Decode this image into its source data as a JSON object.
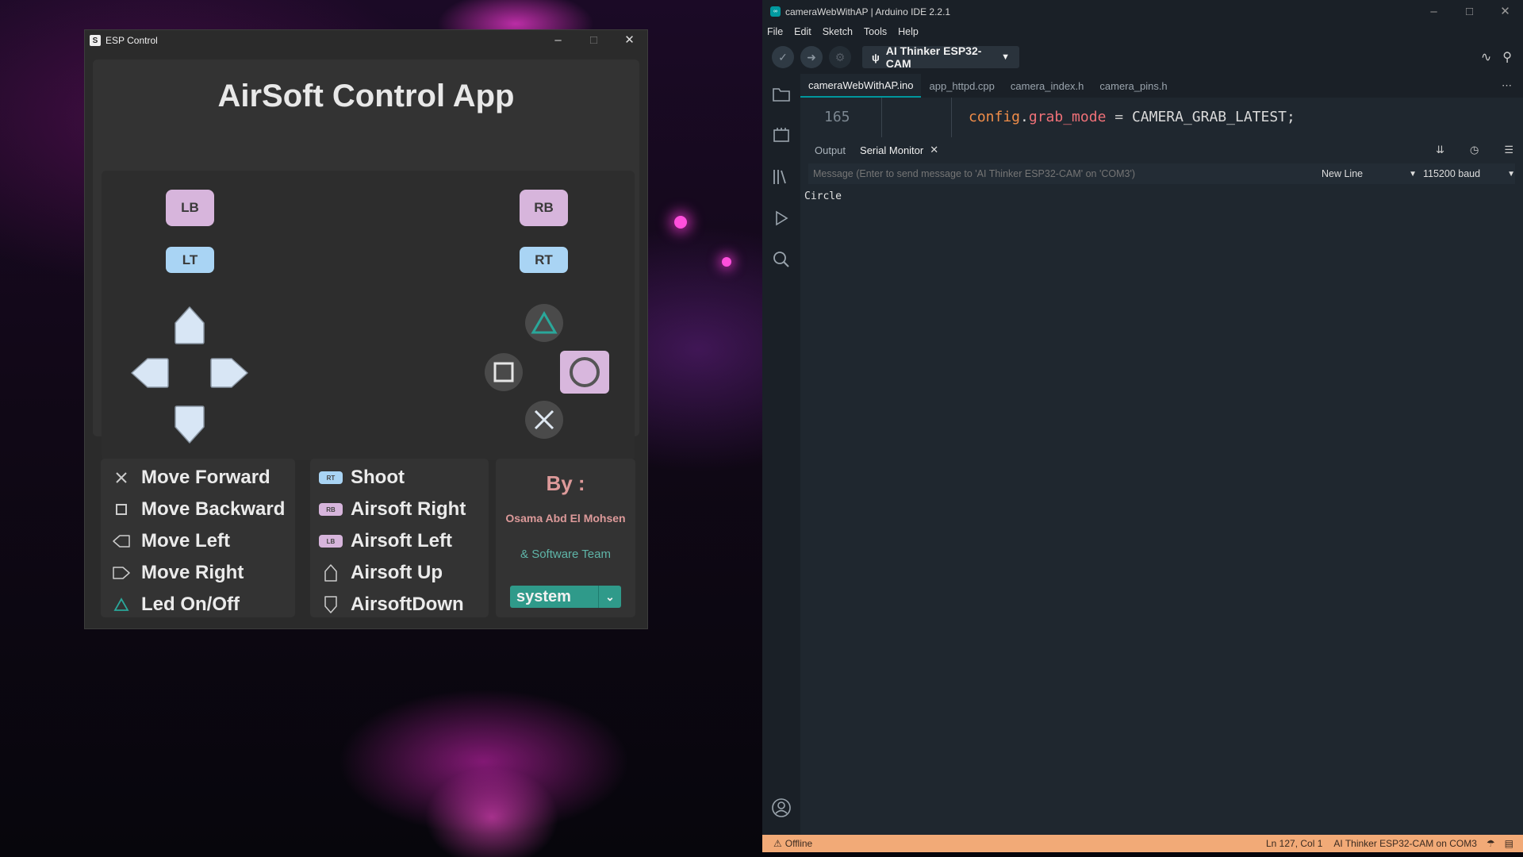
{
  "esp": {
    "window_title": "ESP Control",
    "app_title": "AirSoft Control App",
    "controller": {
      "lb": "LB",
      "rb": "RB",
      "lt": "LT",
      "rt": "RT"
    },
    "legend_left": [
      {
        "icon": "cross-icon",
        "label": "Move Forward"
      },
      {
        "icon": "square-icon",
        "label": "Move Backward"
      },
      {
        "icon": "dpad-left-icon",
        "label": "Move  Left"
      },
      {
        "icon": "dpad-right-icon",
        "label": "Move  Right"
      },
      {
        "icon": "triangle-icon",
        "label": "Led On/Off"
      }
    ],
    "legend_mid": [
      {
        "icon": "rt-tag",
        "tag": "RT",
        "label": "Shoot"
      },
      {
        "icon": "rb-tag",
        "tag": "RB",
        "label": "Airsoft Right"
      },
      {
        "icon": "lb-tag",
        "tag": "LB",
        "label": "Airsoft Left"
      },
      {
        "icon": "dpad-up-icon",
        "label": "Airsoft Up"
      },
      {
        "icon": "dpad-down-icon",
        "label": "AirsoftDown"
      }
    ],
    "credits": {
      "by": "By :",
      "author": "Osama Abd El Mohsen",
      "team": "& Software Team",
      "theme_value": "system"
    },
    "colors": {
      "bumper": "#d7b5dc",
      "trigger": "#a9d4f4",
      "teal": "#2f9a8a",
      "accent_text": "#dd9a9a"
    }
  },
  "ide": {
    "window_title": "cameraWebWithAP | Arduino IDE 2.2.1",
    "menu": [
      "File",
      "Edit",
      "Sketch",
      "Tools",
      "Help"
    ],
    "board": "AI Thinker ESP32-CAM",
    "tabs": [
      "cameraWebWithAP.ino",
      "app_httpd.cpp",
      "camera_index.h",
      "camera_pins.h"
    ],
    "editor": {
      "line_number": "165",
      "code_obj": "config",
      "code_dot": ".",
      "code_prop": "grab_mode",
      "code_eq": " = ",
      "code_val": "CAMERA_GRAB_LATEST;"
    },
    "panel_tabs": {
      "output": "Output",
      "serial": "Serial Monitor"
    },
    "message_placeholder": "Message (Enter to send message to 'AI Thinker ESP32-CAM' on 'COM3')",
    "line_ending": "New Line",
    "baud": "115200 baud",
    "serial_output": "Circle",
    "status": {
      "offline": "Offline",
      "cursor": "Ln 127, Col 1",
      "board_port": "AI Thinker ESP32-CAM on COM3"
    },
    "colors": {
      "accent": "#00979d",
      "status_bar": "#f2aa77"
    }
  }
}
